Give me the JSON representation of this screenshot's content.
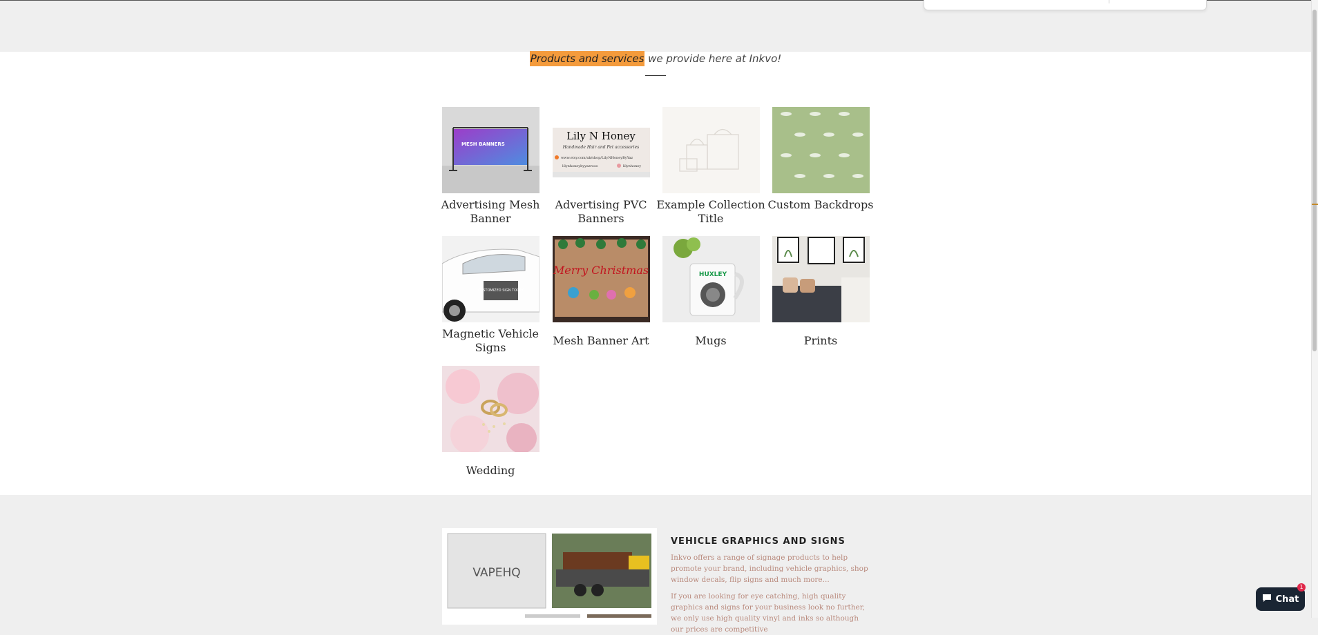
{
  "intro": {
    "highlight": "Products and services",
    "rest": " we provide here at Inkvo!"
  },
  "collections": [
    {
      "label": "Advertising Mesh Banner",
      "image": "mesh-banner-stand",
      "thumb_text": "MESH BANNERS"
    },
    {
      "label": "Advertising PVC Banners",
      "image": "pvc-banner",
      "thumb_text": "Lily N Honey",
      "thumb_sub": "Handmade Hair and Pet accessories",
      "thumb_url": "www.etsy.com/uk/shop/LilyNHoneyByYaz",
      "thumb_handle1": "lilynhoneybyyazroso",
      "thumb_handle2": "lilynhoney"
    },
    {
      "label": "Example Collection Title",
      "image": "placeholder-collection"
    },
    {
      "label": "Custom Backdrops",
      "image": "green-floral-backdrop"
    },
    {
      "label": "Magnetic Vehicle Signs",
      "image": "car-door-sign",
      "thumb_text": "CUSTOMIZED SIGN TODAY"
    },
    {
      "label": "Mesh Banner Art",
      "image": "christmas-banner",
      "thumb_text": "Merry Christmas"
    },
    {
      "label": "Mugs",
      "image": "mug",
      "thumb_text": "HUXLEY"
    },
    {
      "label": "Prints",
      "image": "framed-prints"
    },
    {
      "label": "Wedding",
      "image": "wedding-rings"
    }
  ],
  "promo": {
    "title": "VEHICLE GRAPHICS AND SIGNS",
    "paragraph1": "Inkvo offers a range of signage products to help promote your brand, including vehicle graphics, shop window decals, flip signs and much more...",
    "paragraph2": "If you are looking for eye catching, high quality graphics and signs for your business look no further, we only use high quality vinyl and inks so although our prices are competitive",
    "gallery_text": "VAPEHQ"
  },
  "chat": {
    "label": "Chat",
    "badge": "1"
  },
  "colors": {
    "highlight": "#f49b3c",
    "chat": "#1a2533",
    "badge": "#e0284a",
    "promo_text": "#b98a7d"
  }
}
